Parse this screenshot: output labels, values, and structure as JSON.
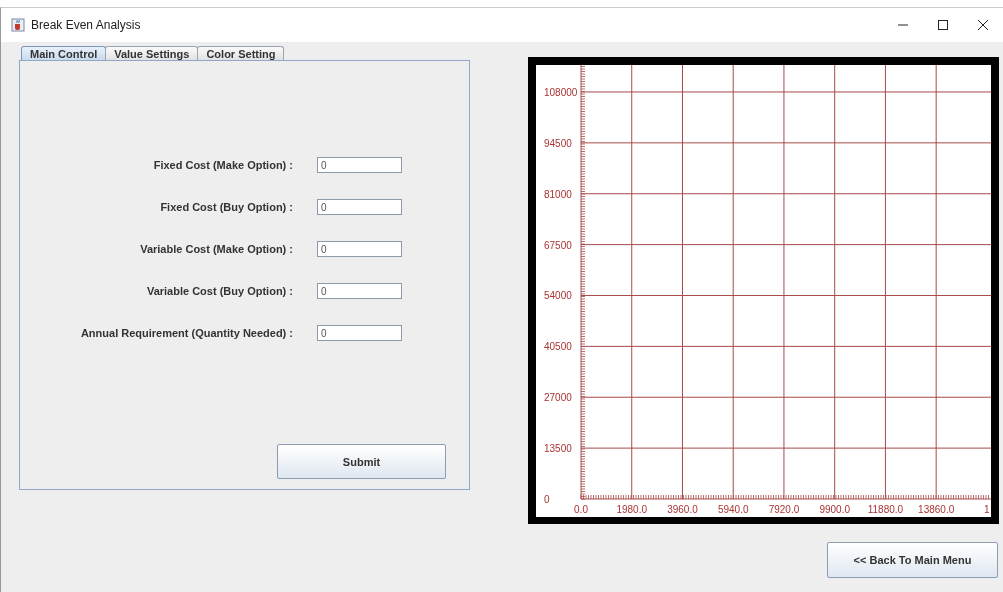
{
  "window": {
    "title": "Break Even Analysis"
  },
  "tabs": [
    {
      "label": "Main Control",
      "selected": true
    },
    {
      "label": "Value Settings",
      "selected": false
    },
    {
      "label": "Color Setting",
      "selected": false
    }
  ],
  "fields": [
    {
      "label": "Fixed Cost (Make Option) :",
      "value": "0"
    },
    {
      "label": "Fixed Cost (Buy Option) :",
      "value": "0"
    },
    {
      "label": "Variable Cost (Make Option) :",
      "value": "0"
    },
    {
      "label": "Variable Cost (Buy Option) :",
      "value": "0"
    },
    {
      "label": "Annual Requirement (Quantity Needed) :",
      "value": "0"
    }
  ],
  "submit_button": "Submit",
  "chart": {
    "chart_data": {
      "type": "line",
      "grid": true,
      "xlim": [
        0,
        16000
      ],
      "ylim": [
        0,
        115000
      ],
      "xticks": [
        {
          "value": 0,
          "label": "0.0"
        },
        {
          "value": 1980,
          "label": "1980.0"
        },
        {
          "value": 3960,
          "label": "3960.0"
        },
        {
          "value": 5940,
          "label": "5940.0"
        },
        {
          "value": 7920,
          "label": "7920.0"
        },
        {
          "value": 9900,
          "label": "9900.0"
        },
        {
          "value": 11880,
          "label": "11880.0"
        },
        {
          "value": 13860,
          "label": "13860.0"
        }
      ],
      "yticks": [
        0,
        13500,
        27000,
        40500,
        54000,
        67500,
        81000,
        94500,
        108000
      ]
    },
    "cut_x_label": "1"
  },
  "back_button": "<< Back To Main Menu"
}
